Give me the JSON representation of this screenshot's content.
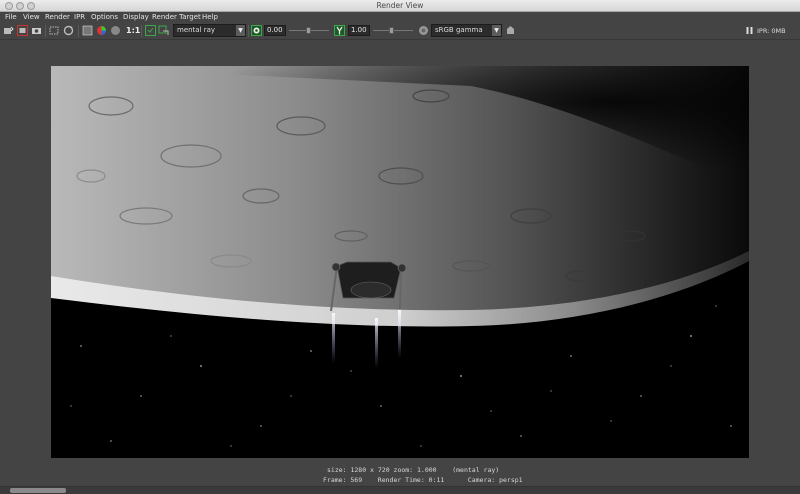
{
  "window": {
    "title": "Render View"
  },
  "menu": [
    "File",
    "View",
    "Render",
    "IPR",
    "Options",
    "Display",
    "Render Target",
    "Help"
  ],
  "toolbar": {
    "ratio_label": "1:1",
    "renderer": "mental ray",
    "exposure": "0.00",
    "gamma": "1.00",
    "color_profile": "sRGB gamma",
    "ipr_memory": "IPR: 0MB",
    "icons": [
      "redo-render-icon",
      "ipr-render-icon",
      "snapshot-icon",
      "render-region-icon",
      "refresh-ipr-icon",
      "rgb-channel-icon",
      "alpha-channel-icon",
      "keep-image-icon",
      "remove-image-icon",
      "exposure-reset-icon",
      "gamma-reset-icon",
      "color-management-icon",
      "save-image-icon",
      "pause-ipr-icon"
    ]
  },
  "render_info": {
    "line1": "size: 1280 x 720 zoom: 1.000    (mental ray)",
    "line2": "Frame: 569    Render Time: 0:11      Camera: persp1"
  },
  "colors": {
    "panel": "#444444",
    "field": "#2b2b2b",
    "accent_red": "#c83232",
    "accent_green": "#3fa64b"
  }
}
